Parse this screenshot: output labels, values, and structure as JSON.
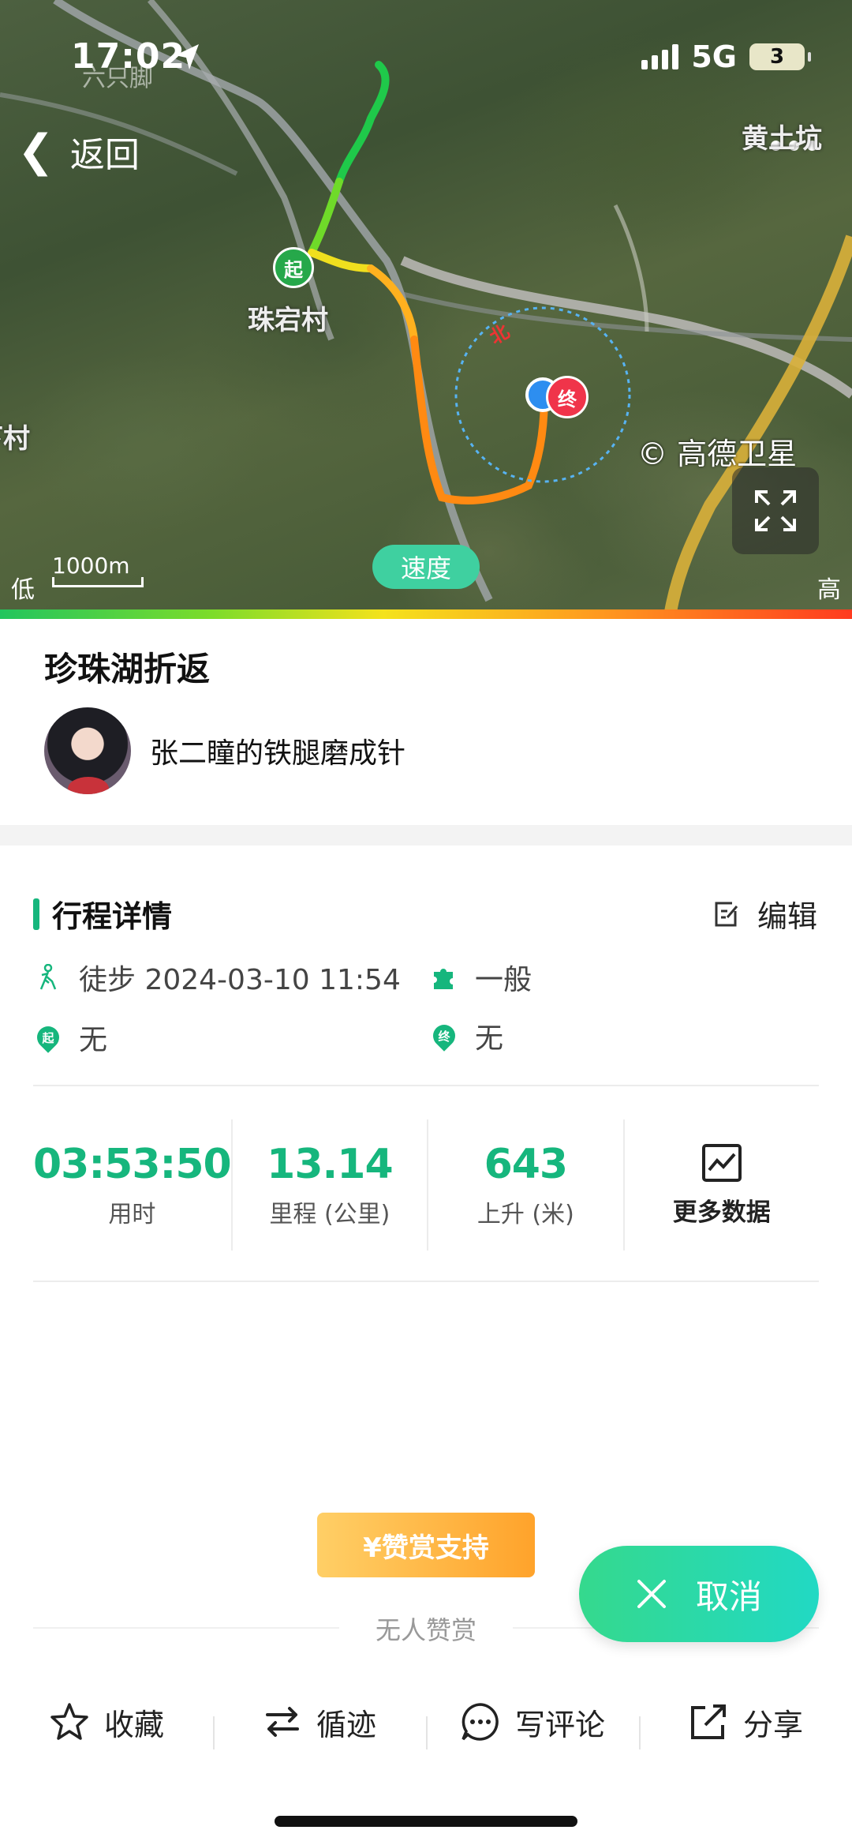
{
  "status_bar": {
    "time": "17:02",
    "network": "5G",
    "battery": "3"
  },
  "map": {
    "back_label": "返回",
    "watermark": "六只脚",
    "place_labels": [
      "珠宕村",
      "黄土坑",
      "下村"
    ],
    "start_marker": "起",
    "end_marker": "终",
    "compass_north": "北",
    "attribution": "© 高德卫星",
    "scale": "1000m",
    "legend_low": "低",
    "legend_high": "高",
    "mode_pill": "速度",
    "icons": [
      "back-chevron-icon",
      "more-icon",
      "fullscreen-icon",
      "location-arrow-icon"
    ]
  },
  "route": {
    "title": "珍珠湖折返",
    "author_name": "张二瞳的铁腿磨成针"
  },
  "details": {
    "section_title": "行程详情",
    "edit_label": "编辑",
    "activity": "徒步 2024-03-10 11:54",
    "difficulty": "一般",
    "start_place": "无",
    "end_place": "无",
    "start_icon_text": "起",
    "end_icon_text": "终"
  },
  "stats": [
    {
      "value": "03:53:50",
      "label": "用时"
    },
    {
      "value": "13.14",
      "label": "里程 (公里)"
    },
    {
      "value": "643",
      "label": "上升 (米)"
    }
  ],
  "more_data_label": "更多数据",
  "reward": {
    "button_label": "¥赞赏支持",
    "empty_text": "无人赞赏"
  },
  "cancel_label": "取消",
  "bottom_bar": {
    "favorite": "收藏",
    "follow_track": "循迹",
    "comment": "写评论",
    "share": "分享"
  },
  "colors": {
    "accent": "#16b67d",
    "reward": "#ffa32b",
    "cancel": "#2ad9a8"
  }
}
